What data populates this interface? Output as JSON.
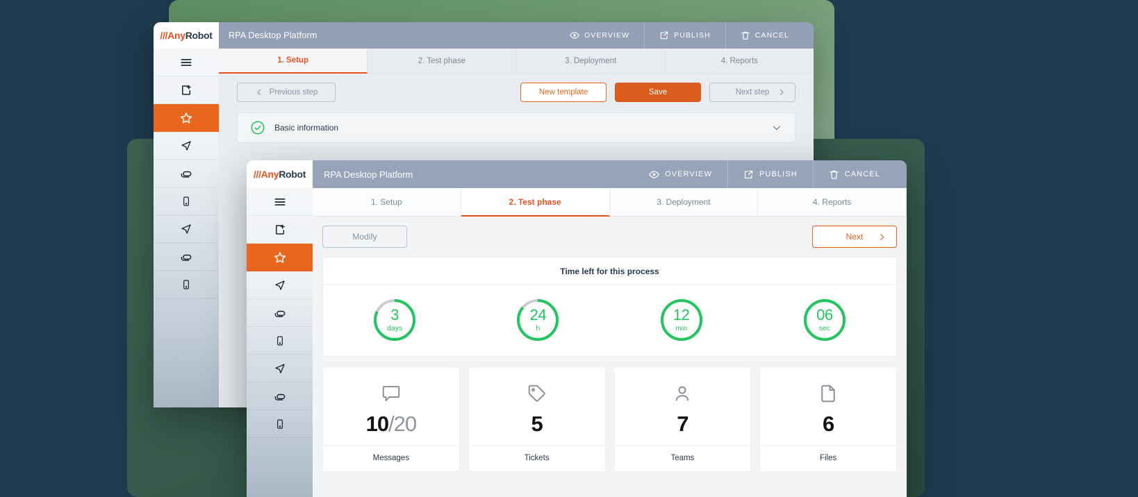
{
  "brand": {
    "slashes": "///",
    "name_accent": "Any",
    "name_dark": "Robot",
    "accent_color": "#e8521f",
    "dark_color": "#2b3a4d"
  },
  "colors": {
    "orange": "#e8651d",
    "orange_solid": "#da5c1d",
    "green": "#22c55e",
    "ring_track": "#c9ccd1",
    "titlebar": "#97a3b8"
  },
  "back_window": {
    "app_title": "RPA Desktop Platform",
    "title_actions": [
      {
        "label": "OVERVIEW",
        "icon": "eye-icon"
      },
      {
        "label": "PUBLISH",
        "icon": "external-link-icon"
      },
      {
        "label": "CANCEL",
        "icon": "trash-icon"
      }
    ],
    "sidebar": {
      "items": [
        {
          "icon": "hamburger-menu-icon",
          "active": false
        },
        {
          "icon": "add-file-icon",
          "active": false
        },
        {
          "icon": "star-icon",
          "active": true
        },
        {
          "icon": "send-icon",
          "active": false
        },
        {
          "icon": "layers-icon",
          "active": false
        },
        {
          "icon": "mobile-icon",
          "active": false
        },
        {
          "icon": "send-icon",
          "active": false
        },
        {
          "icon": "layers-icon",
          "active": false
        },
        {
          "icon": "mobile-icon",
          "active": false
        }
      ]
    },
    "tabs": [
      {
        "label": "1. Setup",
        "active": true
      },
      {
        "label": "2. Test phase",
        "active": false
      },
      {
        "label": "3. Deployment",
        "active": false
      },
      {
        "label": "4. Reports",
        "active": false
      }
    ],
    "toolbar": {
      "previous_step": "Previous step",
      "new_template": "New template",
      "save": "Save",
      "next_step": "Next step"
    },
    "panel": {
      "title": "Basic information",
      "status_icon": "check-circle-icon",
      "toggle_icon": "chevron-down-icon"
    }
  },
  "front_window": {
    "app_title": "RPA Desktop Platform",
    "title_actions": [
      {
        "label": "OVERVIEW",
        "icon": "eye-icon"
      },
      {
        "label": "PUBLISH",
        "icon": "external-link-icon"
      },
      {
        "label": "CANCEL",
        "icon": "trash-icon"
      }
    ],
    "sidebar": {
      "items": [
        {
          "icon": "hamburger-menu-icon",
          "active": false
        },
        {
          "icon": "add-file-icon",
          "active": false
        },
        {
          "icon": "star-icon",
          "active": true
        },
        {
          "icon": "send-icon",
          "active": false
        },
        {
          "icon": "layers-icon",
          "active": false
        },
        {
          "icon": "mobile-icon",
          "active": false
        },
        {
          "icon": "send-icon",
          "active": false
        },
        {
          "icon": "layers-icon",
          "active": false
        },
        {
          "icon": "mobile-icon",
          "active": false
        }
      ]
    },
    "tabs": [
      {
        "label": "1. Setup",
        "active": false
      },
      {
        "label": "2. Test phase",
        "active": true
      },
      {
        "label": "3. Deployment",
        "active": false
      },
      {
        "label": "4. Reports",
        "active": false
      }
    ],
    "toolbar": {
      "modify": "Modify",
      "next": "Next"
    },
    "timer": {
      "title": "Time left for this process",
      "units": [
        {
          "value": "3",
          "unit": "days",
          "percent": 82
        },
        {
          "value": "24",
          "unit": "h",
          "percent": 86
        },
        {
          "value": "12",
          "unit": "min",
          "percent": 100
        },
        {
          "value": "06",
          "unit": "sec",
          "percent": 100
        }
      ]
    },
    "stats": [
      {
        "icon": "chat-bubble-icon",
        "value": "10",
        "value_secondary": "/20",
        "label": "Messages"
      },
      {
        "icon": "tag-icon",
        "value": "5",
        "value_secondary": "",
        "label": "Tickets"
      },
      {
        "icon": "user-icon",
        "value": "7",
        "value_secondary": "",
        "label": "Teams"
      },
      {
        "icon": "document-icon",
        "value": "6",
        "value_secondary": "",
        "label": "Files"
      }
    ]
  }
}
